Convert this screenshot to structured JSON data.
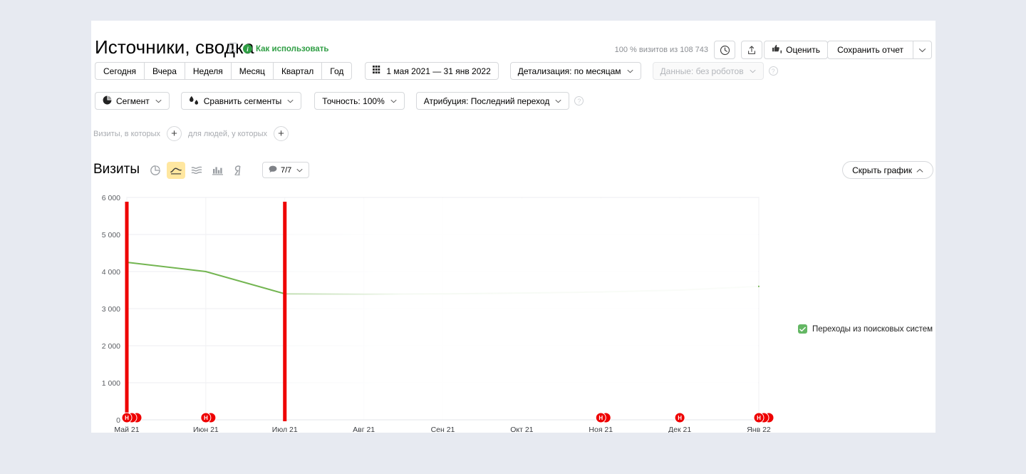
{
  "page": {
    "background": "#e7eaf1",
    "card_background": "#ffffff"
  },
  "header": {
    "title": "Источники, сводка",
    "bookmark_icon": "bookmark-icon",
    "howto_label": "Как использовать",
    "howto_badge": "i",
    "visits_summary": "100 % визитов из 108 743",
    "clock_icon": "clock-icon",
    "share_icon": "share-icon",
    "rate_label": "Оценить",
    "rate_icon": "thumbs-icon",
    "save_label": "Сохранить отчет",
    "save_caret_icon": "chevron-down-icon",
    "accent_green": "#2f9e44"
  },
  "toolbar_periods": {
    "buttons": [
      {
        "label": "Сегодня"
      },
      {
        "label": "Вчера"
      },
      {
        "label": "Неделя"
      },
      {
        "label": "Месяц"
      },
      {
        "label": "Квартал"
      },
      {
        "label": "Год"
      }
    ],
    "date_range": "1 мая 2021 — 31 янв 2022",
    "calendar_icon": "calendar-icon",
    "detail": "Детализация: по месяцам",
    "data_robots": "Данные: без роботов",
    "help_icon": "help-icon"
  },
  "toolbar_segments": {
    "segment": "Сегмент",
    "segment_icon": "pie-segment-icon",
    "compare": "Сравнить сегменты",
    "compare_icon": "compare-drops-icon",
    "precision": "Точность: 100%",
    "attribution": "Атрибуция: Последний переход",
    "help_icon": "help-icon"
  },
  "filters": {
    "visits_label": "Визиты, в которых",
    "people_label": "для людей, у которых",
    "add_icon": "plus-icon"
  },
  "chart_header": {
    "title": "Визиты",
    "types": [
      {
        "name": "pie-chart-icon",
        "selected": false
      },
      {
        "name": "line-chart-icon",
        "selected": true
      },
      {
        "name": "stacked-area-icon",
        "selected": false
      },
      {
        "name": "bar-chart-icon",
        "selected": false
      },
      {
        "name": "map-pin-icon",
        "selected": false
      }
    ],
    "metrics_badge": "7/7",
    "metrics_badge_icon": "bubble-icon",
    "metrics_caret_icon": "chevron-down-icon",
    "hide_chart": "Скрыть график",
    "hide_chart_icon": "chevron-up-icon",
    "selected_bg": "#ffe7a0"
  },
  "chart_data": {
    "type": "line",
    "title": "Визиты",
    "xlabel": "",
    "ylabel": "",
    "grid": true,
    "legend_position": "right",
    "line_color": "#73b551",
    "annotation_color": "#ee0000",
    "categories": [
      "Май 21",
      "Июн 21",
      "Июл 21",
      "Авг 21",
      "Сен 21",
      "Окт 21",
      "Ноя 21",
      "Дек 21",
      "Янв 22"
    ],
    "y_ticks": [
      "0",
      "1 000",
      "2 000",
      "3 000",
      "4 000",
      "5 000",
      "6 000"
    ],
    "ylim": [
      0,
      6000
    ],
    "series": [
      {
        "name": "Переходы из поисковых систем",
        "color": "#73b551",
        "checked": true,
        "values": [
          4250,
          4000,
          3400,
          3390,
          3400,
          3420,
          3450,
          3500,
          3600
        ]
      }
    ],
    "annotations": [
      {
        "at": "Май 21",
        "label": "Н",
        "count": 3,
        "bar": true
      },
      {
        "at": "Июн 21",
        "label": "Н",
        "count": 2,
        "bar": false
      },
      {
        "at": "Июл 21",
        "label": "",
        "count": 0,
        "bar": true
      },
      {
        "at": "Ноя 21",
        "label": "Н",
        "count": 2,
        "bar": false
      },
      {
        "at": "Дек 21",
        "label": "Н",
        "count": 1,
        "bar": false
      },
      {
        "at": "Янв 22",
        "label": "Н",
        "count": 3,
        "bar": false
      }
    ]
  },
  "legend": {
    "label": "Переходы из поисковых систем",
    "checkbox_color": "#64b764",
    "check_icon": "check-icon"
  }
}
